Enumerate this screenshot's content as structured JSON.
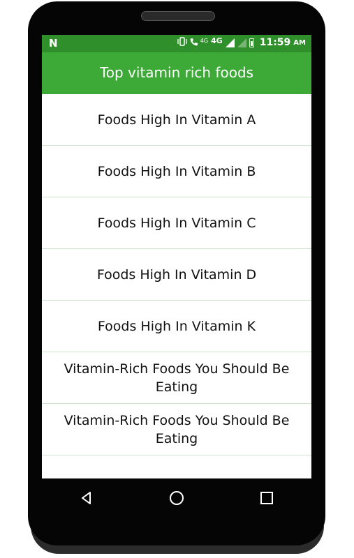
{
  "status_bar": {
    "notification_icon": "N",
    "network_small": "4G",
    "network_large": "4G",
    "time": "11:59",
    "ampm": "AM"
  },
  "app_bar": {
    "title": "Top vitamin rich foods"
  },
  "list": {
    "items": [
      {
        "label": "Foods High In Vitamin A"
      },
      {
        "label": "Foods High In Vitamin B"
      },
      {
        "label": "Foods High In Vitamin C"
      },
      {
        "label": "Foods High In Vitamin D"
      },
      {
        "label": "Foods High In Vitamin K"
      },
      {
        "label": "Vitamin-Rich Foods You Should Be Eating"
      },
      {
        "label": "Vitamin-Rich Foods You Should Be Eating"
      },
      {
        "label": ""
      }
    ]
  },
  "nav_bar": {
    "icons": [
      "back-icon",
      "home-icon",
      "recents-icon"
    ]
  },
  "colors": {
    "status_bar": "#2f8f2b",
    "app_bar": "#3daa38",
    "divider": "#cfe7cc"
  }
}
